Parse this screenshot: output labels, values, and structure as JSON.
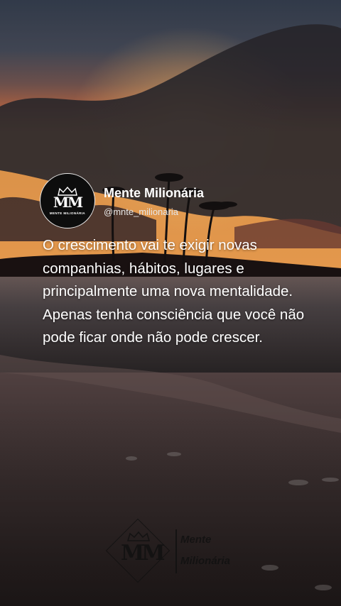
{
  "profile": {
    "name": "Mente Milionária",
    "handle": "@mnte_milionaria",
    "avatar_initials": "MM",
    "avatar_caption": "MENTE MILIONÁRIA"
  },
  "quote": "O crescimento vai te exigir novas companhias, hábitos, lugares e principalmente uma nova mentalidade. Apenas tenha consciência que você não pode ficar onde não pode crescer.",
  "watermark": {
    "initials": "MM",
    "line1": "Mente",
    "line2": "Milionária"
  }
}
